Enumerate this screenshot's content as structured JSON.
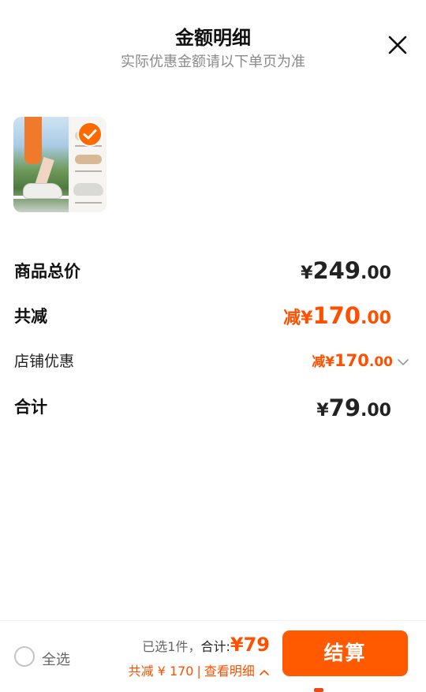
{
  "header": {
    "title": "金额明细",
    "subtitle": "实际优惠金额请以下单页为准"
  },
  "colors": {
    "accent": "#ff5000",
    "checkout_bg": "#ff5a00",
    "subtle_text": "#8a8a8a"
  },
  "product": {
    "selected": true
  },
  "rows": {
    "goods_total": {
      "label": "商品总价",
      "symbol": "¥",
      "int": "249",
      "dec": ".00"
    },
    "total_reduce": {
      "label": "共减",
      "prefix": "减",
      "symbol": "¥",
      "int": "170",
      "dec": ".00"
    },
    "shop_discount": {
      "label": "店铺优惠",
      "prefix": "减",
      "symbol": "¥",
      "int": "170",
      "dec": ".00"
    },
    "subtotal": {
      "label": "合计",
      "symbol": "¥",
      "int": "79",
      "dec": ".00"
    }
  },
  "footer": {
    "select_all": "全选",
    "selected_count": "已选1件，",
    "total_label": "合计:",
    "total_value": "¥79",
    "reduce_text": "共减 ¥ 170",
    "separator": "|",
    "detail_link": "查看明细",
    "checkout_label": "结算"
  }
}
